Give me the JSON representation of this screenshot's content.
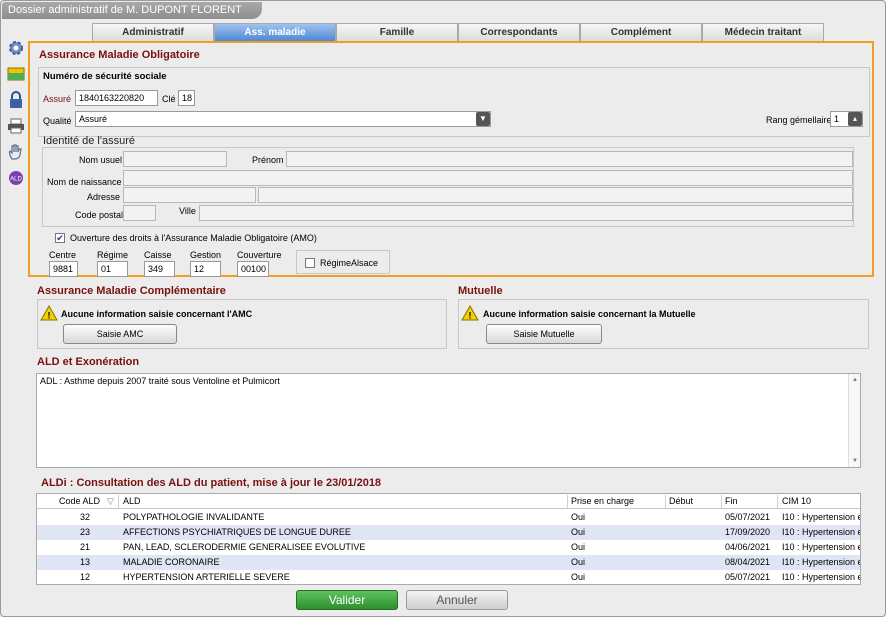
{
  "window": {
    "title": "Dossier administratif de M.  DUPONT FLORENT"
  },
  "tabs": [
    {
      "label": "Administratif",
      "active": false
    },
    {
      "label": "Ass. maladie",
      "active": true
    },
    {
      "label": "Famille",
      "active": false
    },
    {
      "label": "Correspondants",
      "active": false
    },
    {
      "label": "Complément",
      "active": false
    },
    {
      "label": "Médecin traitant",
      "active": false
    }
  ],
  "side_icons": [
    "gear-icon",
    "id-card-icon",
    "lock-icon",
    "printer-icon",
    "hand-icon",
    "ald-badge-icon"
  ],
  "amo": {
    "title": "Assurance Maladie Obligatoire",
    "nss_title": "Numéro de sécurité sociale",
    "assure_label": "Assuré",
    "assure_value": "1840163220820",
    "cle_label": "Clé",
    "cle_value": "18",
    "qualite_label": "Qualité",
    "qualite_value": "Assuré",
    "rang_label": "Rang gémellaire",
    "rang_value": "1",
    "identite_title": "Identité de l'assuré",
    "nom_usuel_label": "Nom usuel",
    "prenom_label": "Prénom",
    "nom_naissance_label": "Nom de naissance",
    "adresse_label": "Adresse",
    "code_postal_label": "Code postal",
    "ville_label": "Ville",
    "ouverture_label": "Ouverture des droits à l'Assurance Maladie Obligatoire (AMO)",
    "ouverture_checked": true,
    "centre_label": "Centre",
    "centre_value": "9881",
    "regime_label": "Régime",
    "regime_value": "01",
    "caisse_label": "Caisse",
    "caisse_value": "349",
    "gestion_label": "Gestion",
    "gestion_value": "12",
    "couverture_label": "Couverture",
    "couverture_value": "00100",
    "regime_alsace_label": "RégimeAlsace",
    "regime_alsace_checked": false
  },
  "amc": {
    "title": "Assurance Maladie Complémentaire",
    "message": "Aucune information saisie concernant l'AMC",
    "button": "Saisie AMC"
  },
  "mutuelle": {
    "title": "Mutuelle",
    "message": "Aucune information saisie concernant la Mutuelle",
    "button": "Saisie Mutuelle"
  },
  "ald": {
    "title": "ALD et Exonération",
    "text": "ADL : Asthme depuis 2007 traité sous Ventoline et Pulmicort"
  },
  "aldi": {
    "title": "ALDi : Consultation des ALD du patient, mise à jour le 23/01/2018",
    "columns": [
      "Code ALD",
      "ALD",
      "Prise en charge",
      "Début",
      "Fin",
      "CIM 10"
    ],
    "rows": [
      {
        "code": "32",
        "ald": "POLYPATHOLOGIE INVALIDANTE",
        "prise": "Oui",
        "debut": "",
        "fin": "05/07/2021",
        "cim": "I10 : Hypertension e"
      },
      {
        "code": "23",
        "ald": "AFFECTIONS PSYCHIATRIQUES DE LONGUE DUREE",
        "prise": "Oui",
        "debut": "",
        "fin": "17/09/2020",
        "cim": "I10 : Hypertension e"
      },
      {
        "code": "21",
        "ald": "PAN, LEAD, SCLERODERMIE GENERALISEE EVOLUTIVE",
        "prise": "Oui",
        "debut": "",
        "fin": "04/06/2021",
        "cim": "I10 : Hypertension e"
      },
      {
        "code": "13",
        "ald": "MALADIE CORONAIRE",
        "prise": "Oui",
        "debut": "",
        "fin": "08/04/2021",
        "cim": "I10 : Hypertension e"
      },
      {
        "code": "12",
        "ald": "HYPERTENSION ARTERIELLE SEVERE",
        "prise": "Oui",
        "debut": "",
        "fin": "05/07/2021",
        "cim": "I10 : Hypertension e"
      }
    ]
  },
  "footer": {
    "valider": "Valider",
    "annuler": "Annuler"
  },
  "colors": {
    "accent_orange": "#f0a020",
    "section_title": "#7a1010",
    "tab_active": "#4f86d6",
    "valider_green": "#3fa63f"
  }
}
